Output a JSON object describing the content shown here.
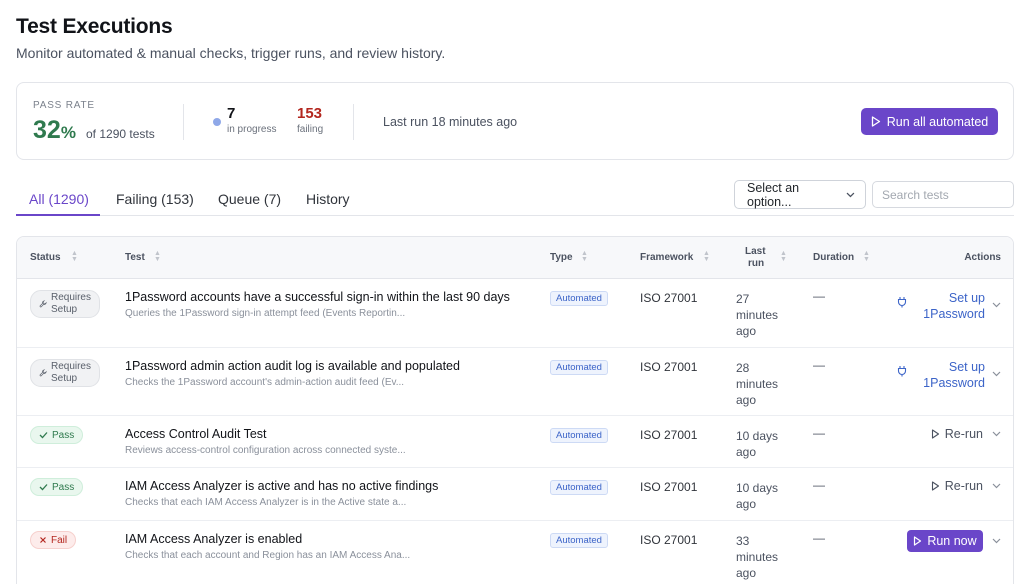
{
  "header": {
    "title": "Test Executions",
    "subtitle": "Monitor automated & manual checks, trigger runs, and review history."
  },
  "summary": {
    "pass_rate_label": "PASS RATE",
    "pass_rate_value": "32",
    "pass_rate_unit": "%",
    "pass_rate_total": "of 1290 tests",
    "in_progress_count": "7",
    "in_progress_label": "in progress",
    "failing_count": "153",
    "failing_label": "failing",
    "last_run": "Last run 18 minutes ago",
    "run_all_label": "Run all automated"
  },
  "tabs": [
    {
      "label": "All (1290)",
      "active": true
    },
    {
      "label": "Failing (153)",
      "active": false
    },
    {
      "label": "Queue (7)",
      "active": false
    },
    {
      "label": "History",
      "active": false
    }
  ],
  "filters": {
    "select_value": "Select an option...",
    "search_placeholder": "Search tests"
  },
  "table": {
    "columns": {
      "status": "Status",
      "test": "Test",
      "type": "Type",
      "framework": "Framework",
      "last_run_line1": "Last",
      "last_run_line2": "run",
      "duration": "Duration",
      "actions": "Actions"
    },
    "rows": [
      {
        "status": "Requires Setup",
        "status_line1": "Requires",
        "status_line2": "Setup",
        "name": "1Password accounts have a successful sign-in within the last 90 days",
        "description": "Queries the 1Password sign-in attempt feed (Events Reportin...",
        "type": "Automated",
        "framework": "ISO 27001",
        "last_run": "27 minutes ago",
        "duration": "—",
        "action": "Set up 1Password",
        "action_line1": "Set up",
        "action_line2": "1Password"
      },
      {
        "status": "Requires Setup",
        "status_line1": "Requires",
        "status_line2": "Setup",
        "name": "1Password admin action audit log is available and populated",
        "description": "Checks the 1Password account's admin-action audit feed (Ev...",
        "type": "Automated",
        "framework": "ISO 27001",
        "last_run": "28 minutes ago",
        "duration": "—",
        "action": "Set up 1Password",
        "action_line1": "Set up",
        "action_line2": "1Password"
      },
      {
        "status": "Pass",
        "name": "Access Control Audit Test",
        "description": "Reviews access-control configuration across connected syste...",
        "type": "Automated",
        "framework": "ISO 27001",
        "last_run": "10 days ago",
        "duration": "—",
        "action": "Re-run"
      },
      {
        "status": "Pass",
        "name": "IAM Access Analyzer is active and has no active findings",
        "description": "Checks that each IAM Access Analyzer is in the Active state a...",
        "type": "Automated",
        "framework": "ISO 27001",
        "last_run": "10 days ago",
        "duration": "—",
        "action": "Re-run"
      },
      {
        "status": "Fail",
        "name": "IAM Access Analyzer is enabled",
        "description": "Checks that each account and Region has an IAM Access Ana...",
        "type": "Automated",
        "framework": "ISO 27001",
        "last_run": "33 minutes ago",
        "duration": "—",
        "action": "Run now"
      }
    ]
  },
  "colors": {
    "accent": "#6a46c9",
    "pass": "#2f7a4e",
    "fail": "#b3261e",
    "link": "#3c64c8"
  }
}
